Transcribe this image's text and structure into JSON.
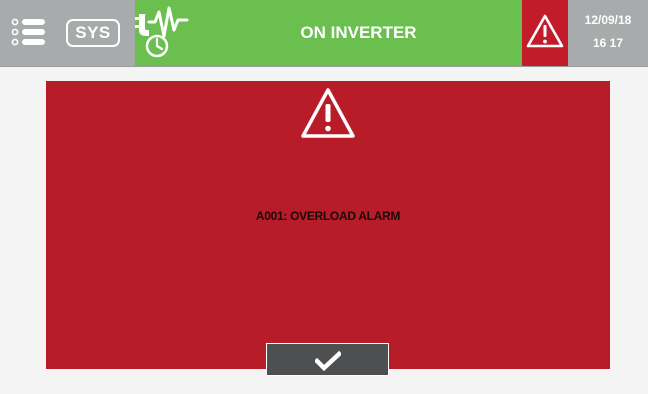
{
  "topbar": {
    "menu_icon": "menu-list-icon",
    "sys_label": "SYS",
    "status_icon": "plug-waveform-clock-icon",
    "status_text": "ON INVERTER",
    "alarm_icon": "warning-triangle-icon",
    "date": "12/09/18",
    "time": "16 17"
  },
  "alarm_dialog": {
    "icon": "warning-triangle-icon",
    "message": "A001: OVERLOAD ALARM",
    "confirm_icon": "checkmark-icon"
  },
  "colors": {
    "topbar_gray": "#a7abab",
    "status_green": "#6bbf4e",
    "alarm_red": "#c21b2a",
    "panel_red": "#b81c28",
    "button_dark": "#4e4f51"
  }
}
